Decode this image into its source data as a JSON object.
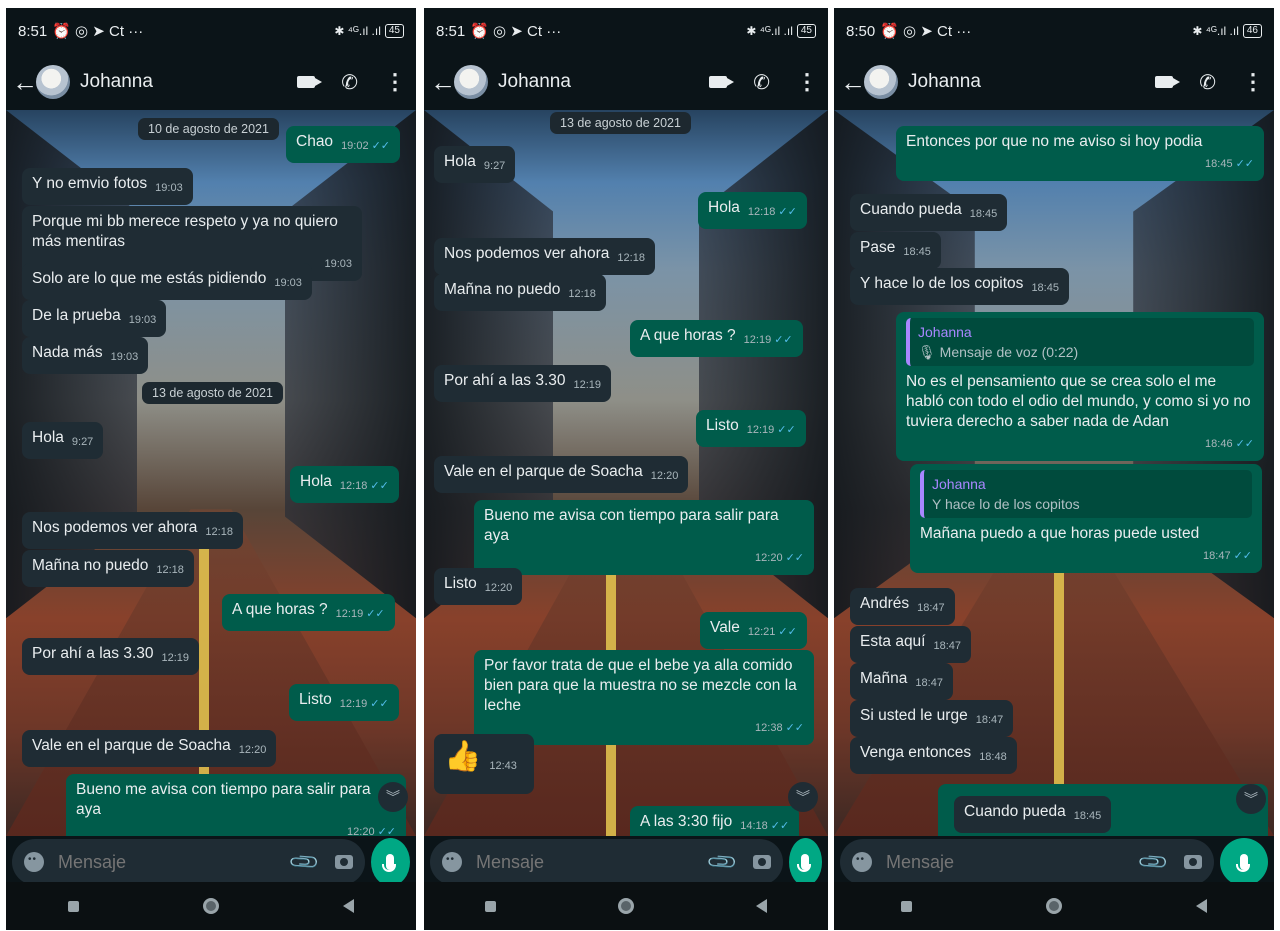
{
  "phones": [
    {
      "status": {
        "time": "8:51",
        "icons": "⏰ ◎ ➤ Ct ···",
        "signal": "✱ ⁴ᴳ.ıl .ıl",
        "battery": "45"
      },
      "header": {
        "name": "Johanna"
      },
      "messages": [
        {
          "type": "date",
          "text": "10 de agosto de 2021"
        },
        {
          "dir": "out",
          "text": "Chao",
          "time": "19:02"
        },
        {
          "dir": "in",
          "text": "Y no emvio fotos",
          "time": "19:03"
        },
        {
          "dir": "in",
          "text": "Porque mi bb merece respeto y ya no quiero más mentiras",
          "time": "19:03"
        },
        {
          "dir": "in",
          "text": "Solo are lo que me estás pidiendo",
          "time": "19:03"
        },
        {
          "dir": "in",
          "text": "De la prueba",
          "time": "19:03"
        },
        {
          "dir": "in",
          "text": "Nada más",
          "time": "19:03"
        },
        {
          "type": "date",
          "text": "13 de agosto de 2021"
        },
        {
          "dir": "in",
          "text": "Hola",
          "time": "9:27"
        },
        {
          "dir": "out",
          "text": "Hola",
          "time": "12:18"
        },
        {
          "dir": "in",
          "text": "Nos podemos ver ahora",
          "time": "12:18"
        },
        {
          "dir": "in",
          "text": "Mañna no puedo",
          "time": "12:18"
        },
        {
          "dir": "out",
          "text": "A que horas ?",
          "time": "12:19"
        },
        {
          "dir": "in",
          "text": "Por ahí a las 3.30",
          "time": "12:19"
        },
        {
          "dir": "out",
          "text": "Listo",
          "time": "12:19"
        },
        {
          "dir": "in",
          "text": "Vale en el parque de Soacha",
          "time": "12:20"
        },
        {
          "dir": "out",
          "text": "Bueno me avisa con tiempo para salir para aya",
          "time": "12:20"
        }
      ],
      "input_placeholder": "Mensaje"
    },
    {
      "status": {
        "time": "8:51",
        "icons": "⏰ ◎ ➤ Ct ···",
        "signal": "✱ ⁴ᴳ.ıl .ıl",
        "battery": "45"
      },
      "header": {
        "name": "Johanna"
      },
      "messages": [
        {
          "type": "date",
          "text": "13 de agosto de 2021"
        },
        {
          "dir": "in",
          "text": "Hola",
          "time": "9:27"
        },
        {
          "dir": "out",
          "text": "Hola",
          "time": "12:18"
        },
        {
          "dir": "in",
          "text": "Nos podemos ver ahora",
          "time": "12:18"
        },
        {
          "dir": "in",
          "text": "Mañna no puedo",
          "time": "12:18"
        },
        {
          "dir": "out",
          "text": "A que horas ?",
          "time": "12:19"
        },
        {
          "dir": "in",
          "text": "Por ahí a las 3.30",
          "time": "12:19"
        },
        {
          "dir": "out",
          "text": "Listo",
          "time": "12:19"
        },
        {
          "dir": "in",
          "text": "Vale en el parque de Soacha",
          "time": "12:20"
        },
        {
          "dir": "out",
          "text": "Bueno me avisa con tiempo para salir para aya",
          "time": "12:20"
        },
        {
          "dir": "in",
          "text": "Listo",
          "time": "12:20"
        },
        {
          "dir": "out",
          "text": "Vale",
          "time": "12:21"
        },
        {
          "dir": "out",
          "text": "Por favor trata de que el bebe ya alla comido bien para que la muestra no se mezcle con la leche",
          "time": "12:38"
        },
        {
          "dir": "in",
          "text": "👍",
          "time": "12:43"
        },
        {
          "dir": "out",
          "text": "A las 3:30 fijo",
          "time": "14:18"
        }
      ],
      "input_placeholder": "Mensaje"
    },
    {
      "status": {
        "time": "8:50",
        "icons": "⏰ ◎ ➤ Ct ···",
        "signal": "✱ ⁴ᴳ.ıl .ıl",
        "battery": "46"
      },
      "header": {
        "name": "Johanna"
      },
      "messages": [
        {
          "dir": "out",
          "text": "Entonces por que no me aviso si hoy podia",
          "time": "18:45"
        },
        {
          "dir": "in",
          "text": "Cuando pueda",
          "time": "18:45"
        },
        {
          "dir": "in",
          "text": "Pase",
          "time": "18:45"
        },
        {
          "dir": "in",
          "text": "Y hace lo de los copitos",
          "time": "18:45"
        },
        {
          "dir": "out",
          "quote_name": "Johanna",
          "quote_text": "🎙 Mensaje de voz (0:22)",
          "text": "No es el pensamiento que se crea solo el me habló con todo el odio del mundo, y como si yo no tuviera derecho a saber nada de Adan",
          "time": "18:46"
        },
        {
          "dir": "out",
          "quote_name": "Johanna",
          "quote_text": "Y hace lo de los copitos",
          "text": "Mañana puedo a que horas puede usted",
          "time": "18:47"
        },
        {
          "dir": "in",
          "text": "Andrés",
          "time": "18:47"
        },
        {
          "dir": "in",
          "text": "Esta aquí",
          "time": "18:47"
        },
        {
          "dir": "in",
          "text": "Mañna",
          "time": "18:47"
        },
        {
          "dir": "in",
          "text": "Si usted le urge",
          "time": "18:47"
        },
        {
          "dir": "in",
          "text": "Venga entonces",
          "time": "18:48"
        },
        {
          "dir": "in",
          "text": "Cuando pueda",
          "time": "18:45"
        }
      ],
      "input_placeholder": "Mensaje"
    }
  ],
  "colors": {
    "incoming": "#1f2c34",
    "outgoing": "#005c4b",
    "accent": "#00a884",
    "ticks": "#53bdeb"
  }
}
